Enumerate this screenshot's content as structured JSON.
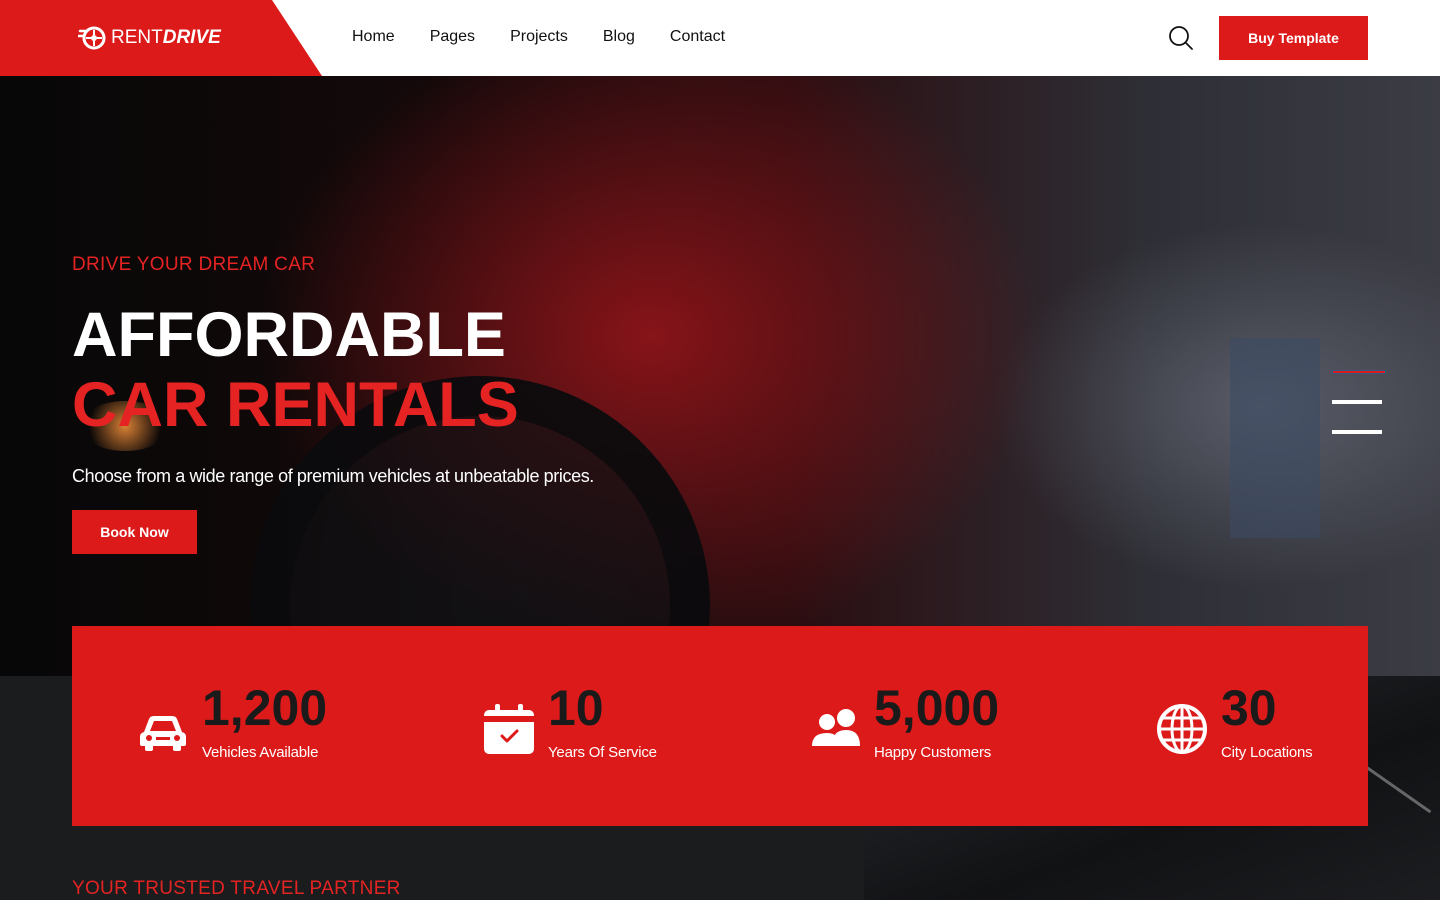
{
  "header": {
    "logo": {
      "part1": "RENT",
      "part2": "DRIVE"
    },
    "nav": [
      "Home",
      "Pages",
      "Projects",
      "Blog",
      "Contact"
    ],
    "buy_label": "Buy Template"
  },
  "hero": {
    "eyebrow": "DRIVE YOUR DREAM CAR",
    "title_line1": "AFFORDABLE",
    "title_line2": "CAR RENTALS",
    "subtitle": "Choose from a wide range of premium vehicles at unbeatable prices.",
    "cta_label": "Book Now"
  },
  "slider": {
    "count": 3,
    "active_index": 0
  },
  "stats": [
    {
      "icon": "car-icon",
      "value": "1,200",
      "label": "Vehicles Available"
    },
    {
      "icon": "calendar-check-icon",
      "value": "10",
      "label": "Years Of Service"
    },
    {
      "icon": "users-icon",
      "value": "5,000",
      "label": "Happy Customers"
    },
    {
      "icon": "globe-icon",
      "value": "30",
      "label": "City Locations"
    }
  ],
  "section": {
    "eyebrow": "YOUR TRUSTED TRAVEL PARTNER"
  },
  "colors": {
    "accent": "#dd1a1a",
    "accent_text": "#e52323",
    "dark": "#1b1c1e"
  }
}
